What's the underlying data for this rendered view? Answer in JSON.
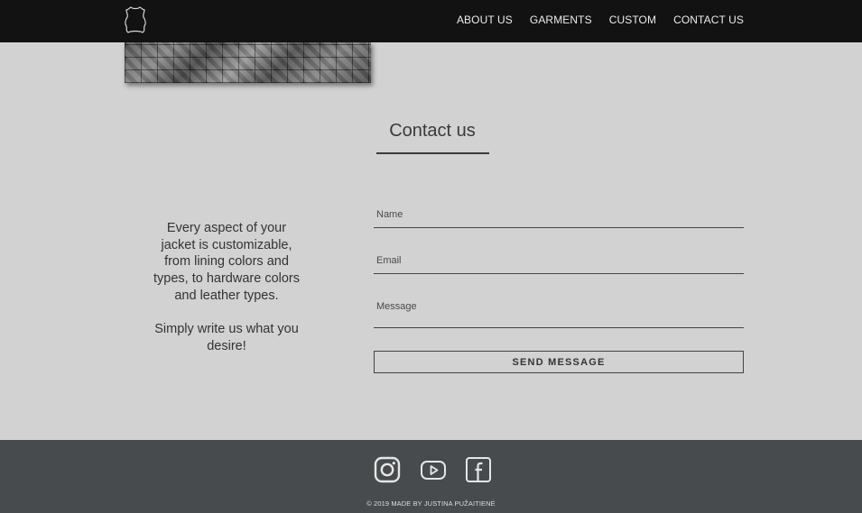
{
  "header": {
    "nav": [
      "ABOUT US",
      "GARMENTS",
      "CUSTOM",
      "CONTACT US"
    ]
  },
  "contact": {
    "title": "Contact us",
    "intro_p1": "Every aspect of your jacket is customizable, from lining colors and types, to hardware colors and leather types.",
    "intro_p2": "Simply write us what you desire!",
    "name_placeholder": "Name",
    "email_placeholder": "Email",
    "message_placeholder": "Message",
    "send_label": "SEND MESSAGE"
  },
  "footer": {
    "social_icons": [
      "instagram-icon",
      "youtube-icon",
      "facebook-icon"
    ],
    "copyright": "© 2019 MADE BY JUSTINA PUŽAITIENĖ"
  },
  "colors": {
    "header_bg": "#121212",
    "page_bg": "#d2d2d2",
    "footer_bg": "#474b4e"
  }
}
